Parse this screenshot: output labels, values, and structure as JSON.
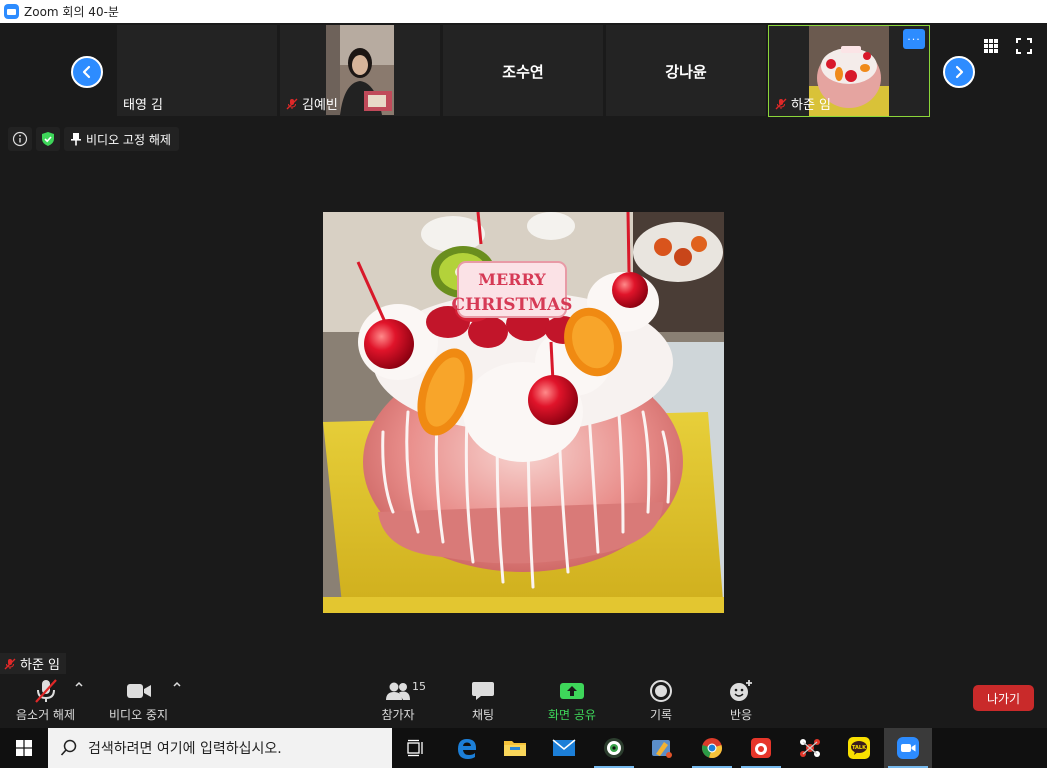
{
  "window": {
    "title": "Zoom 회의 40-분"
  },
  "gallery": {
    "tiles": [
      {
        "name": "태영 김",
        "muted": false,
        "video": false
      },
      {
        "name": "김예빈",
        "muted": true,
        "video": true
      },
      {
        "name": "조수연",
        "muted": false,
        "video": false
      },
      {
        "name": "강나윤",
        "muted": false,
        "video": false
      },
      {
        "name": "하준 임",
        "muted": true,
        "video": true,
        "active": true
      }
    ],
    "more_label": "···"
  },
  "info_bar": {
    "unpin_label": "비디오 고정 해제"
  },
  "active_speaker": {
    "name": "하준 임"
  },
  "controls": {
    "audio_label": "음소거 해제",
    "video_label": "비디오 중지",
    "participants_label": "참가자",
    "participants_count": "15",
    "chat_label": "채팅",
    "share_label": "화면 공유",
    "record_label": "기록",
    "reactions_label": "반응",
    "leave_label": "나가기"
  },
  "taskbar": {
    "search_placeholder": "검색하려면 여기에 입력하십시오."
  },
  "colors": {
    "zoom_blue": "#2d8cff",
    "share_green": "#3ed65a",
    "leave_red": "#c92a2a",
    "active_border": "#8bd63a",
    "mute_red": "#e02828"
  },
  "cake_text": "MERRY CHRISTMAS"
}
